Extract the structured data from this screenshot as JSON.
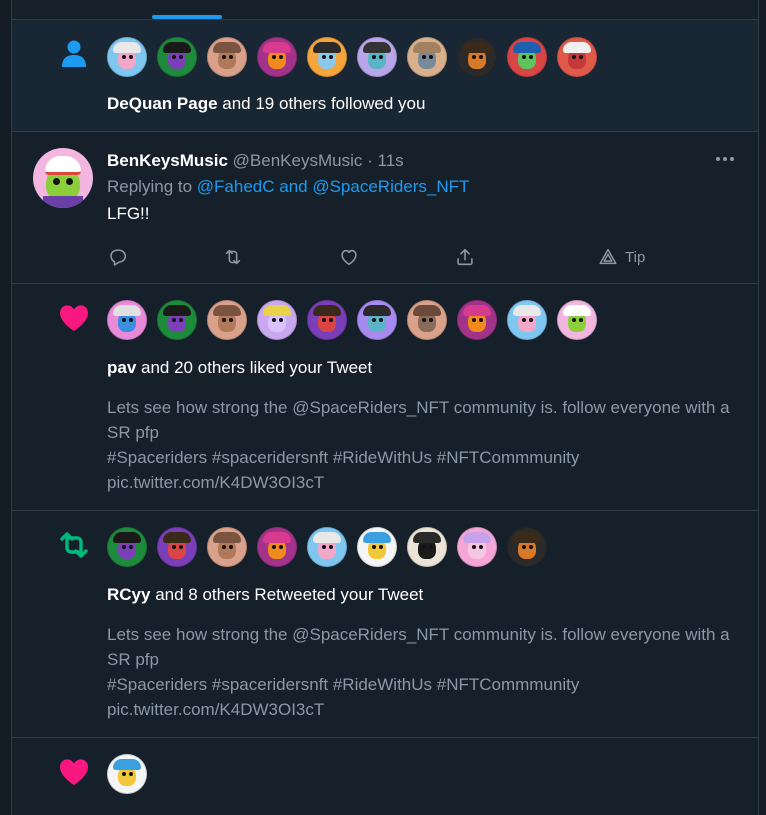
{
  "notifications": {
    "follow": {
      "icon": "person-icon",
      "actor": "DeQuan Page",
      "rest": " and 19 others followed you",
      "avatars": [
        {
          "bg": "#7fc7f0",
          "face": "#f2a7c9",
          "visor": "#e8e8e8"
        },
        {
          "bg": "#1e8a3c",
          "face": "#7b3fb8",
          "visor": "#1a1a1a"
        },
        {
          "bg": "#d9a08a",
          "face": "#b07a5a",
          "visor": "#7a5440"
        },
        {
          "bg": "#a3328a",
          "face": "#f08a1c",
          "visor": "#d63b8f"
        },
        {
          "bg": "#f5a53b",
          "face": "#8cc8e8",
          "visor": "#2a2a2a"
        },
        {
          "bg": "#b9a6e8",
          "face": "#5bb3c7",
          "visor": "#333333"
        },
        {
          "bg": "#d8b08c",
          "face": "#7a8a9a",
          "visor": "#a28060"
        },
        {
          "bg": "#2a2a2a",
          "face": "#d67a2a",
          "visor": "#3a2a1a"
        },
        {
          "bg": "#d94545",
          "face": "#5ec45e",
          "visor": "#1d5fb0"
        },
        {
          "bg": "#e05a4a",
          "face": "#c43a3a",
          "visor": "#f0f0f0"
        }
      ]
    },
    "tweet": {
      "name": "BenKeysMusic",
      "handle": "@BenKeysMusic",
      "separator": "·",
      "time": "11s",
      "replying_prefix": "Replying to ",
      "replying_to": "@FahedC and @SpaceRiders_NFT",
      "text": "LFG!!",
      "tip_label": "Tip",
      "avatar": {
        "bg": "#f3b6e0",
        "face": "#8ccf3a",
        "visor": "#ffffff"
      }
    },
    "like": {
      "icon": "heart-icon",
      "actor": "pav",
      "rest": " and 20 others liked your Tweet",
      "quoted_text": "Lets see how strong the @SpaceRiders_NFT  community is. follow everyone with a SR pfp\n#Spaceriders #spaceridersnft #RideWithUs #NFTCommmunity\npic.twitter.com/K4DW3OI3cT",
      "avatars": [
        {
          "bg": "#e98ad8",
          "face": "#3a8fe0",
          "visor": "#e0e0e0"
        },
        {
          "bg": "#1e8a3c",
          "face": "#7b3fb8",
          "visor": "#1a1a1a"
        },
        {
          "bg": "#d9a08a",
          "face": "#b07a5a",
          "visor": "#7a5440"
        },
        {
          "bg": "#c9a8f0",
          "face": "#d9c2ff",
          "visor": "#e8d24a"
        },
        {
          "bg": "#7a3fb8",
          "face": "#d94545",
          "visor": "#3a2a1a"
        },
        {
          "bg": "#a78af0",
          "face": "#5bb3c7",
          "visor": "#2a2a2a"
        },
        {
          "bg": "#d9a08a",
          "face": "#8a6a58",
          "visor": "#6a4a3a"
        },
        {
          "bg": "#a3328a",
          "face": "#f08a1c",
          "visor": "#d63b8f"
        },
        {
          "bg": "#7fc7f0",
          "face": "#f2a7c9",
          "visor": "#e8e8e8"
        },
        {
          "bg": "#f3b6e0",
          "face": "#8ccf3a",
          "visor": "#ffffff"
        }
      ]
    },
    "retweet": {
      "icon": "retweet-icon",
      "actor": "RCyy",
      "rest": " and 8 others Retweeted your Tweet",
      "quoted_text": "Lets see how strong the @SpaceRiders_NFT  community is. follow everyone with a SR pfp\n#Spaceriders #spaceridersnft #RideWithUs #NFTCommmunity\npic.twitter.com/K4DW3OI3cT",
      "avatars": [
        {
          "bg": "#1e8a3c",
          "face": "#7b3fb8",
          "visor": "#1a1a1a"
        },
        {
          "bg": "#7a3fb8",
          "face": "#d94545",
          "visor": "#3a2a1a"
        },
        {
          "bg": "#d9a08a",
          "face": "#b07a5a",
          "visor": "#7a5440"
        },
        {
          "bg": "#a3328a",
          "face": "#f08a1c",
          "visor": "#d63b8f"
        },
        {
          "bg": "#7fc7f0",
          "face": "#f2a7c9",
          "visor": "#e8e8e8"
        },
        {
          "bg": "#f5f5f5",
          "face": "#f0c83a",
          "visor": "#3aa0e0"
        },
        {
          "bg": "#ece4d6",
          "face": "#1a1a1a",
          "visor": "#2a2a2a"
        },
        {
          "bg": "#f5a6d6",
          "face": "#f5c6e0",
          "visor": "#c8a2e8"
        },
        {
          "bg": "#2a2a2a",
          "face": "#d67a2a",
          "visor": "#3a2a1a"
        }
      ]
    },
    "like2": {
      "icon": "heart-icon",
      "avatars": [
        {
          "bg": "#f5f5f5",
          "face": "#f0c83a",
          "visor": "#3aa0e0"
        }
      ]
    }
  },
  "colors": {
    "accent": "#1d9bf0",
    "like": "#f91880",
    "retweet": "#00ba7c",
    "background": "#15202b"
  }
}
